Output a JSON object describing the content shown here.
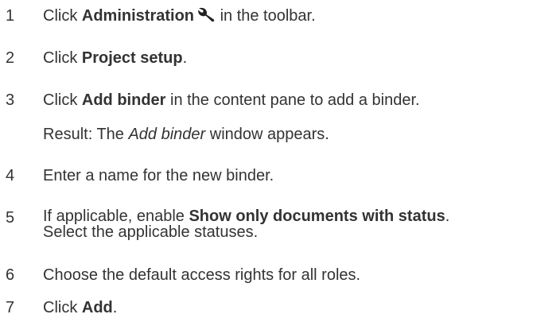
{
  "steps": [
    {
      "number": "1",
      "before": "Click ",
      "bold": "Administration",
      "icon": "wrench-icon",
      "after": " in the toolbar."
    },
    {
      "number": "2",
      "before": "Click ",
      "bold": "Project setup",
      "after": "."
    },
    {
      "number": "3",
      "before": "Click ",
      "bold": "Add binder",
      "after": " in the content pane to add a binder.",
      "result": {
        "prefix": "Result: The ",
        "italic": "Add binder",
        "suffix": " window appears."
      }
    },
    {
      "number": "4",
      "text": "Enter a name for the new binder."
    },
    {
      "number": "5",
      "before": "If applicable, enable ",
      "bold": "Show only documents with status",
      "after": ".",
      "line2": "Select the applicable statuses."
    },
    {
      "number": "6",
      "text": "Choose the default access rights for all roles."
    },
    {
      "number": "7",
      "before": "Click ",
      "bold": "Add",
      "after": "."
    }
  ]
}
